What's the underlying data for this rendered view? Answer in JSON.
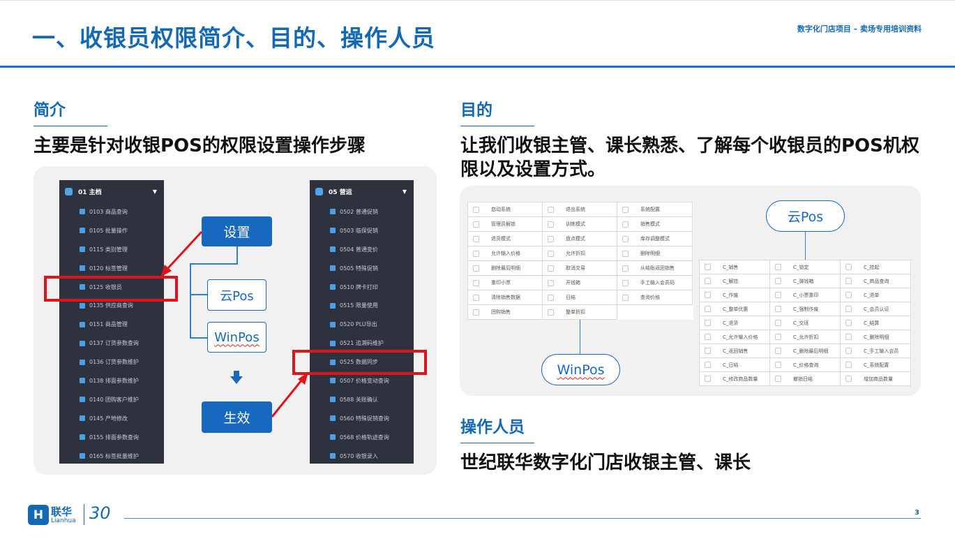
{
  "header": {
    "title": "一、收银员权限简介、目的、操作人员",
    "subtitle": "数字化门店项目 – 卖场专用培训资料"
  },
  "intro": {
    "heading": "简介",
    "text": "主要是针对收银POS的权限设置操作步骤"
  },
  "left_menu": {
    "header": "01 主档",
    "items": [
      "0103 商品查询",
      "0105 批量操作",
      "0115 类别管理",
      "0120 标签管理",
      "0125 收银员",
      "0135 供应商查询",
      "0151 商品管理",
      "0137 订货参数查询",
      "0136 订货参数维护",
      "0138 排面参数维护",
      "0140 团购客户维护",
      "0145 产地修改",
      "0155 排面参数查询",
      "0165 标签批量维护"
    ]
  },
  "right_menu": {
    "header": "05 营运",
    "items": [
      "0502 普通促销",
      "0503 临保促销",
      "0504 普通变价",
      "0505 特殊促销",
      "0510 牌卡打印",
      "0515 限量使用",
      "0520 PLU导出",
      "0521 追溯码维护",
      "0525 数据同步",
      "0507 价格变动查询",
      "0588 关账确认",
      "0560 特殊促销查询",
      "0568 价格轨迹查询",
      "0570 收银录入"
    ]
  },
  "flow": {
    "setup": "设置",
    "yunpos": "云Pos",
    "winpos": "WinPos",
    "effect": "生效"
  },
  "purpose": {
    "heading": "目的",
    "text": "让我们收银主管、课长熟悉、了解每个收银员的POS机权限以及设置方式。"
  },
  "winpos_table": [
    [
      "启动系统",
      "退出系统",
      "系统配置"
    ],
    [
      "管理员解锁",
      "训练模式",
      "销售模式"
    ],
    [
      "退货模式",
      "盘点模式",
      "库存调整模式"
    ],
    [
      "允许输入价格",
      "允许折扣",
      "删除明细"
    ],
    [
      "删除最后明细",
      "取消交易",
      "从结账返回销售"
    ],
    [
      "重印小票",
      "开钱箱",
      "手工输入会员码"
    ],
    [
      "清除销售数据",
      "日结",
      "查询价格"
    ],
    [
      "团购销售",
      "整单折扣",
      ""
    ]
  ],
  "yunpos_table": [
    [
      "C_销售",
      "C_锁定",
      "C_挂起"
    ],
    [
      "C_解挂",
      "C_弹钱箱",
      "C_商品查询"
    ],
    [
      "C_作废",
      "C_小票重印",
      "C_退单"
    ],
    [
      "C_整单优惠",
      "C_强制作废",
      "C_会员认证"
    ],
    [
      "C_退货",
      "C_交班",
      "C_结算"
    ],
    [
      "C_允许输入价格",
      "C_允许折扣",
      "C_删除明细"
    ],
    [
      "C_返回销售",
      "C_删除最后明细",
      "C_手工输入会员"
    ],
    [
      "C_日结",
      "C_价格查询",
      "C_系统配置"
    ],
    [
      "C_修改商品数量",
      "撤销日结",
      "增加商品数量"
    ]
  ],
  "operators": {
    "heading": "操作人员",
    "text": "世纪联华数字化门店收银主管、课长"
  },
  "footer": {
    "logo_cn": "联华",
    "logo_en": "Lianhua",
    "logo_30": "30",
    "page": "3"
  },
  "colors": {
    "brand": "#1469b4",
    "highlight": "#e0131a",
    "menu_bg": "#2d323e"
  }
}
